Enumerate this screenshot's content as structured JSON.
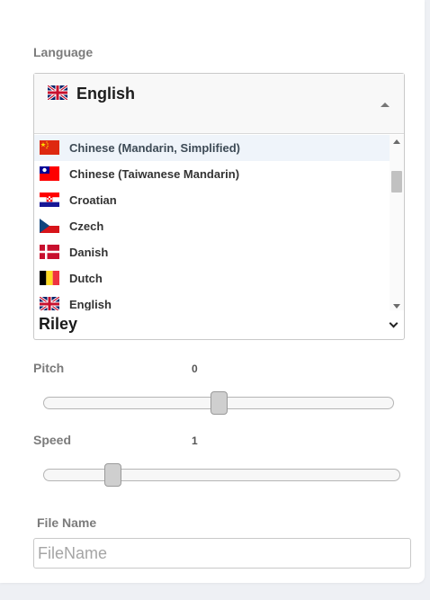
{
  "language": {
    "label": "Language",
    "selected": "English",
    "options": [
      "Chinese (Mandarin, Simplified)",
      "Chinese (Taiwanese Mandarin)",
      "Croatian",
      "Czech",
      "Danish",
      "Dutch",
      "English"
    ],
    "highlighted_index": 0
  },
  "voice": {
    "selected": "Riley"
  },
  "pitch": {
    "label": "Pitch",
    "value": "0",
    "position_fraction": 0.5
  },
  "speed": {
    "label": "Speed",
    "value": "1",
    "position_fraction": 0.18
  },
  "file_name": {
    "label": "File Name",
    "placeholder": "FileName"
  },
  "colors": {
    "highlight": "#eff4fa",
    "label_gray": "#7b7b7b"
  }
}
